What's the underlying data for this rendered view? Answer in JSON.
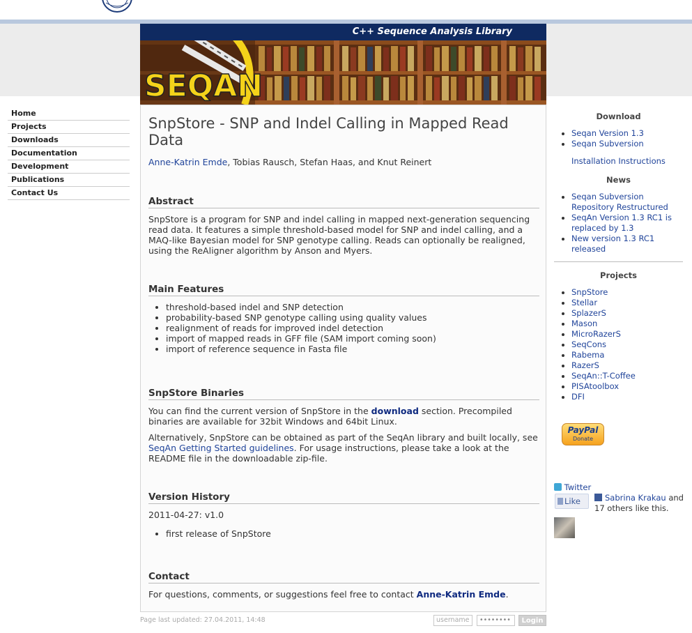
{
  "banner": {
    "tagline": "C++ Sequence Analysis Library",
    "logo": "SEQAN"
  },
  "leftnav": [
    "Home",
    "Projects",
    "Downloads",
    "Documentation",
    "Development",
    "Publications",
    "Contact Us"
  ],
  "main": {
    "title": "SnpStore - SNP and Indel Calling in Mapped Read Data",
    "author_link": "Anne-Katrin Emde",
    "author_rest": ", Tobias Rausch, Stefan Haas, and Knut Reinert",
    "abstract": {
      "heading": "Abstract",
      "text": "SnpStore is a program for SNP and indel calling in mapped next-generation sequencing read data. It features a simple threshold-based model for SNP and indel calling, and a MAQ-like Bayesian model for SNP genotype calling. Reads can optionally be realigned, using the ReAligner algorithm by Anson and Myers."
    },
    "features": {
      "heading": "Main Features",
      "items": [
        "threshold-based indel and SNP detection",
        "probability-based SNP genotype calling using quality values",
        "realignment of reads for improved indel detection",
        "import of mapped reads in GFF file (SAM import coming soon)",
        "import of reference sequence in Fasta file"
      ]
    },
    "binaries": {
      "heading": "SnpStore Binaries",
      "p1_before": "You can find the current version of SnpStore in the ",
      "p1_link": "download",
      "p1_after": " section. Precompiled binaries are available for 32bit Windows and 64bit Linux.",
      "p2_before": "Alternatively, SnpStore can be obtained as part of the SeqAn library and built locally, see ",
      "p2_link": "SeqAn Getting Started guidelines",
      "p2_after": ". For usage instructions, please take a look at the README file in the downloadable zip-file."
    },
    "history": {
      "heading": "Version History",
      "date": "2011-04-27: v1.0",
      "items": [
        "first release of SnpStore"
      ]
    },
    "contact": {
      "heading": "Contact",
      "before": "For questions, comments, or suggestions feel free to contact ",
      "link": "Anne-Katrin Emde",
      "after": "."
    }
  },
  "right": {
    "download": {
      "heading": "Download",
      "items": [
        "Seqan Version 1.3",
        "Seqan Subversion"
      ],
      "install": "Installation Instructions"
    },
    "news": {
      "heading": "News",
      "items": [
        "Seqan Subversion Repository Restructured",
        "SeqAn Version 1.3 RC1 is replaced by 1.3",
        "New version 1.3 RC1 released"
      ]
    },
    "projects": {
      "heading": "Projects",
      "items": [
        "SnpStore",
        "Stellar",
        "SplazerS",
        "Mason",
        "MicroRazerS",
        "SeqCons",
        "Rabema",
        "RazerS",
        "SeqAn::T-Coffee",
        "PISAtoolbox",
        "DFI"
      ]
    },
    "paypal": {
      "logo": "PayPal",
      "label": "Donate"
    },
    "twitter": "Twitter",
    "like": "Like",
    "fb_name": "Sabrina Krakau",
    "fb_rest": " and 17 others like this."
  },
  "footer": {
    "updated": "Page last updated: 27.04.2011, 14:48",
    "username_placeholder": "username",
    "password_mask": "••••••••",
    "login": "Login"
  },
  "colors": {
    "link": "#20449a",
    "bluebar": "#0f2a61",
    "stripe": "#b9c8de"
  }
}
